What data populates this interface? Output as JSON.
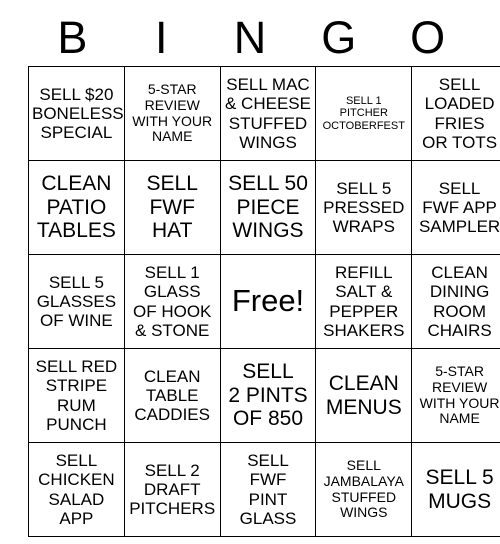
{
  "card": {
    "header_letters": [
      "B",
      "I",
      "N",
      "G",
      "O"
    ],
    "columns": 5,
    "rows": 5,
    "colors": {
      "background": "#ffffff",
      "text": "#000000",
      "border": "#000000"
    },
    "cells": [
      [
        {
          "text": "SELL $20\nBONELESS\nSPECIAL",
          "size": "md",
          "free": false
        },
        {
          "text": "5-STAR\nREVIEW\nWITH YOUR\nNAME",
          "size": "sm",
          "free": false
        },
        {
          "text": "SELL MAC\n& CHEESE\nSTUFFED\nWINGS",
          "size": "md",
          "free": false
        },
        {
          "text": "SELL 1\nPITCHER\nOCTOBERFEST",
          "size": "xs",
          "free": false
        },
        {
          "text": "SELL\nLOADED\nFRIES\nOR TOTS",
          "size": "md",
          "free": false
        }
      ],
      [
        {
          "text": "CLEAN\nPATIO\nTABLES",
          "size": "lg",
          "free": false
        },
        {
          "text": "SELL\nFWF\nHAT",
          "size": "lg",
          "free": false
        },
        {
          "text": "SELL 50\nPIECE\nWINGS",
          "size": "lg",
          "free": false
        },
        {
          "text": "SELL 5\nPRESSED\nWRAPS",
          "size": "md",
          "free": false
        },
        {
          "text": "SELL\nFWF APP\nSAMPLER",
          "size": "md",
          "free": false
        }
      ],
      [
        {
          "text": "SELL 5\nGLASSES\nOF WINE",
          "size": "md",
          "free": false
        },
        {
          "text": "SELL 1\nGLASS\nOF HOOK\n& STONE",
          "size": "md",
          "free": false
        },
        {
          "text": "Free!",
          "size": "xl",
          "free": true
        },
        {
          "text": "REFILL\nSALT &\nPEPPER\nSHAKERS",
          "size": "md",
          "free": false
        },
        {
          "text": "CLEAN\nDINING\nROOM\nCHAIRS",
          "size": "md",
          "free": false
        }
      ],
      [
        {
          "text": "SELL RED\nSTRIPE\nRUM\nPUNCH",
          "size": "md",
          "free": false
        },
        {
          "text": "CLEAN\nTABLE\nCADDIES",
          "size": "md",
          "free": false
        },
        {
          "text": "SELL\n2 PINTS\nOF 850",
          "size": "lg",
          "free": false
        },
        {
          "text": "CLEAN\nMENUS",
          "size": "lg",
          "free": false
        },
        {
          "text": "5-STAR\nREVIEW\nWITH YOUR\nNAME",
          "size": "sm",
          "free": false
        }
      ],
      [
        {
          "text": "SELL\nCHICKEN\nSALAD\nAPP",
          "size": "md",
          "free": false
        },
        {
          "text": "SELL 2\nDRAFT\nPITCHERS",
          "size": "md",
          "free": false
        },
        {
          "text": "SELL\nFWF\nPINT\nGLASS",
          "size": "md",
          "free": false
        },
        {
          "text": "SELL\nJAMBALAYA\nSTUFFED\nWINGS",
          "size": "sm",
          "free": false
        },
        {
          "text": "SELL 5\nMUGS",
          "size": "lg",
          "free": false
        }
      ]
    ]
  }
}
